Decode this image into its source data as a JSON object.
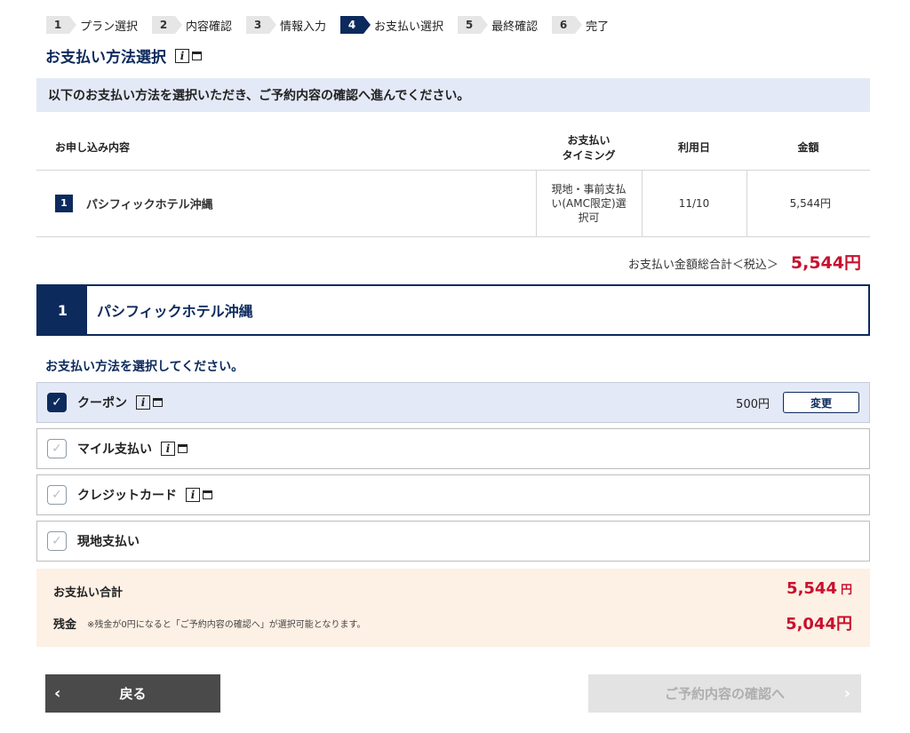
{
  "steps": [
    {
      "num": "1",
      "label": "プラン選択"
    },
    {
      "num": "2",
      "label": "内容確認"
    },
    {
      "num": "3",
      "label": "情報入力"
    },
    {
      "num": "4",
      "label": "お支払い選択"
    },
    {
      "num": "5",
      "label": "最終確認"
    },
    {
      "num": "6",
      "label": "完了"
    }
  ],
  "active_step": "4",
  "page_title": "お支払い方法選択",
  "notice": "以下のお支払い方法を選択いただき、ご予約内容の確認へ進んでください。",
  "table": {
    "headers": {
      "content": "お申し込み内容",
      "timing_line1": "お支払い",
      "timing_line2": "タイミング",
      "date": "利用日",
      "amount": "金額"
    },
    "rows": [
      {
        "num": "1",
        "name": "パシフィックホテル沖縄",
        "timing_line1": "現地・事前支払",
        "timing_line2": "い(AMC限定)選",
        "timing_line3": "択可",
        "date": "11/10",
        "amount": "5,544円"
      }
    ]
  },
  "total": {
    "label": "お支払い金額総合計＜税込＞",
    "amount": "5,544円"
  },
  "section": {
    "num": "1",
    "title": "パシフィックホテル沖縄"
  },
  "select_prompt": "お支払い方法を選択してください。",
  "payment_options": [
    {
      "label": "クーポン",
      "checked": true,
      "amount": "500円",
      "button": "変更"
    },
    {
      "label": "マイル支払い",
      "checked": false
    },
    {
      "label": "クレジットカード",
      "checked": false
    },
    {
      "label": "現地支払い",
      "checked": false
    }
  ],
  "summary": {
    "total_label": "お支払い合計",
    "total_amount": "5,544",
    "total_unit": "円",
    "balance_label": "残金",
    "balance_note": "※残金が0円になると「ご予約内容の確認へ」が選択可能となります。",
    "balance_amount": "5,044円"
  },
  "buttons": {
    "back": "戻る",
    "next": "ご予約内容の確認へ"
  },
  "colors": {
    "navy": "#0c2a5c",
    "price_red": "#c8102e",
    "notice_bg": "#e4e9f7",
    "summary_bg": "#fdf0e4"
  }
}
